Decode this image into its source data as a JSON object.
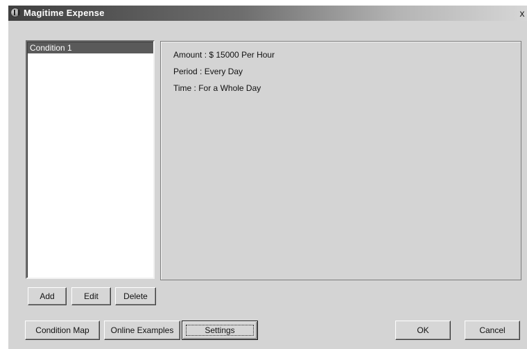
{
  "window": {
    "title": "Magitime Expense",
    "close_label": "x"
  },
  "conditions": {
    "items": [
      "Condition 1"
    ],
    "selected_index": 0
  },
  "details": {
    "amount": "Amount : $ 15000 Per Hour",
    "period": "Period : Every Day",
    "time": "Time : For a Whole Day"
  },
  "list_buttons": {
    "add": "Add",
    "edit": "Edit",
    "delete": "Delete"
  },
  "bottom_buttons": {
    "condition_map": "Condition Map",
    "online_examples": "Online Examples",
    "settings": "Settings",
    "ok": "OK",
    "cancel": "Cancel"
  },
  "icons": {
    "app": "magitime-app-icon",
    "close": "close-icon"
  }
}
